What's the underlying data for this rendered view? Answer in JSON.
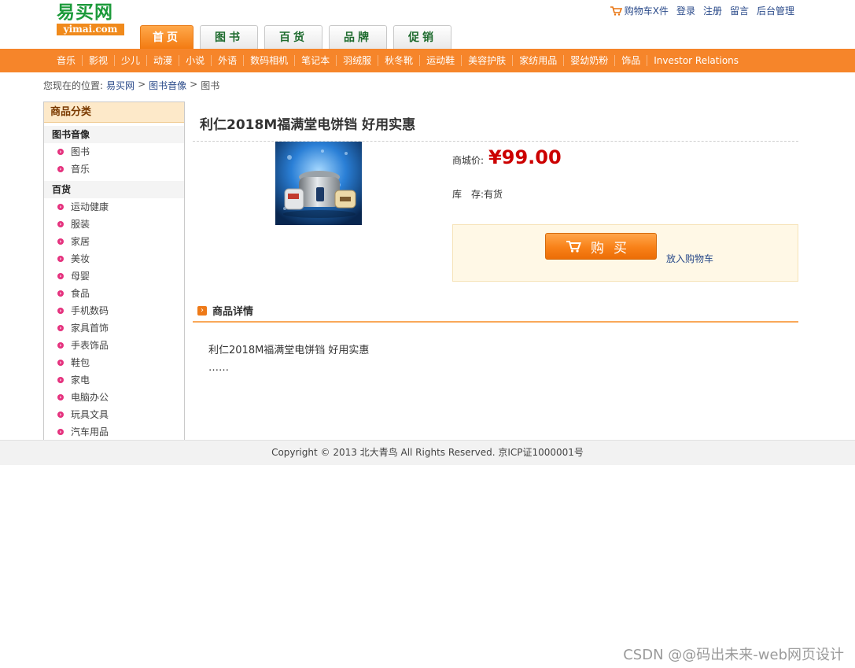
{
  "header": {
    "logo_cn": "易买网",
    "logo_en": "yimai.com",
    "links": {
      "cart": "购物车X件",
      "login": "登录",
      "register": "注册",
      "message": "留言",
      "admin": "后台管理"
    },
    "tabs": [
      {
        "label": "首页",
        "active": true
      },
      {
        "label": "图书",
        "active": false
      },
      {
        "label": "百货",
        "active": false
      },
      {
        "label": "品牌",
        "active": false
      },
      {
        "label": "促销",
        "active": false
      }
    ]
  },
  "nav": {
    "items": [
      "音乐",
      "影视",
      "少儿",
      "动漫",
      "小说",
      "外语",
      "数码相机",
      "笔记本",
      "羽绒服",
      "秋冬靴",
      "运动鞋",
      "美容护肤",
      "家纺用品",
      "婴幼奶粉",
      "饰品",
      "Investor Relations"
    ]
  },
  "breadcrumb": {
    "prefix": "您现在的位置:",
    "items": [
      "易买网",
      "图书音像",
      "图书"
    ],
    "sep": ">"
  },
  "sidebar": {
    "title": "商品分类",
    "groups": [
      {
        "label": "图书音像",
        "items": [
          "图书",
          "音乐"
        ]
      },
      {
        "label": "百货",
        "items": [
          "运动健康",
          "服装",
          "家居",
          "美妆",
          "母婴",
          "食品",
          "手机数码",
          "家具首饰",
          "手表饰品",
          "鞋包",
          "家电",
          "电脑办公",
          "玩具文具",
          "汽车用品"
        ]
      }
    ]
  },
  "product": {
    "title": "利仁2018M福满堂电饼铛 好用实惠",
    "price_label": "商城价:",
    "price": "¥99.00",
    "stock_label": "库　存:",
    "stock_value": "有货",
    "buy_label": "购买",
    "add_cart_label": "放入购物车"
  },
  "details": {
    "title": "商品详情",
    "text": "利仁2018M福满堂电饼铛 好用实惠",
    "more": "……"
  },
  "footer": {
    "copyright": "Copyright © 2013 北大青鸟 All Rights Reserved. 京ICP证1000001号"
  },
  "watermark": "CSDN @@码出未来-web网页设计",
  "colors": {
    "accent": "#f6852a",
    "price": "#cc0000",
    "link": "#2a4a8a",
    "bullet": "#e5327e"
  },
  "icons": [
    "cart-icon",
    "bullet-arrow-icon",
    "detail-arrow-icon"
  ]
}
